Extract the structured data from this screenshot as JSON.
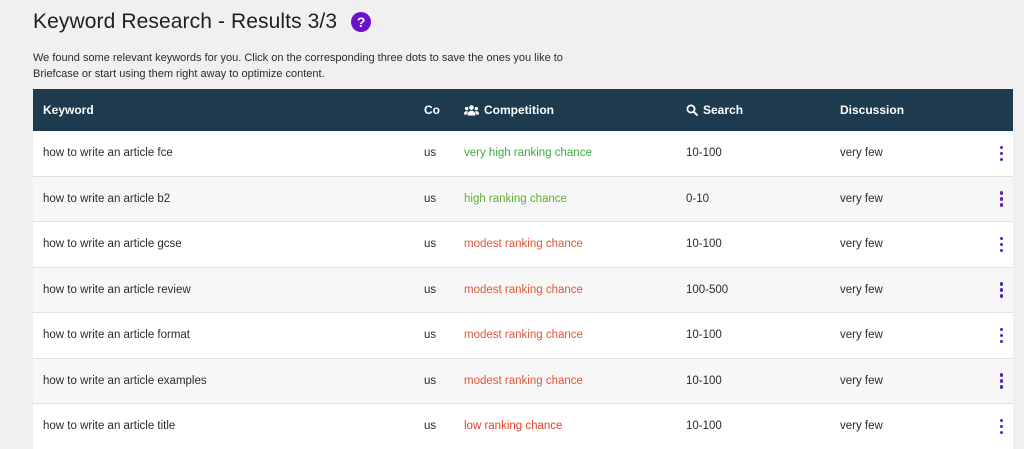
{
  "header": {
    "title": "Keyword Research - Results 3/3",
    "help_icon_glyph": "?",
    "description": "We found some relevant keywords for you. Click on the corresponding three dots to save the ones you like to Briefcase or start using them right away to optimize content."
  },
  "table": {
    "columns": {
      "keyword": "Keyword",
      "country": "Co",
      "competition": "Competition",
      "search": "Search",
      "discussion": "Discussion"
    },
    "rows": [
      {
        "keyword": "how to write an article fce",
        "country": "us",
        "competition": "very high ranking chance",
        "competition_level": "very-high",
        "search": "10-100",
        "discussion": "very few"
      },
      {
        "keyword": "how to write an article b2",
        "country": "us",
        "competition": "high ranking chance",
        "competition_level": "high",
        "search": "0-10",
        "discussion": "very few"
      },
      {
        "keyword": "how to write an article gcse",
        "country": "us",
        "competition": "modest ranking chance",
        "competition_level": "modest",
        "search": "10-100",
        "discussion": "very few"
      },
      {
        "keyword": "how to write an article review",
        "country": "us",
        "competition": "modest ranking chance",
        "competition_level": "modest",
        "search": "100-500",
        "discussion": "very few"
      },
      {
        "keyword": "how to write an article format",
        "country": "us",
        "competition": "modest ranking chance",
        "competition_level": "modest",
        "search": "10-100",
        "discussion": "very few"
      },
      {
        "keyword": "how to write an article examples",
        "country": "us",
        "competition": "modest ranking chance",
        "competition_level": "modest",
        "search": "10-100",
        "discussion": "very few"
      },
      {
        "keyword": "how to write an article title",
        "country": "us",
        "competition": "low ranking chance",
        "competition_level": "low",
        "search": "10-100",
        "discussion": "very few"
      }
    ]
  },
  "colors": {
    "header_bg": "#1d3a4e",
    "accent": "#6a11cb",
    "very_high": "#3bab3b",
    "high": "#63ad32",
    "modest": "#e0563a",
    "low": "#e0442d"
  },
  "icons": {
    "help": "question-circle-icon",
    "competition": "users-icon",
    "search": "search-icon",
    "row_menu": "vertical-dots-icon"
  }
}
